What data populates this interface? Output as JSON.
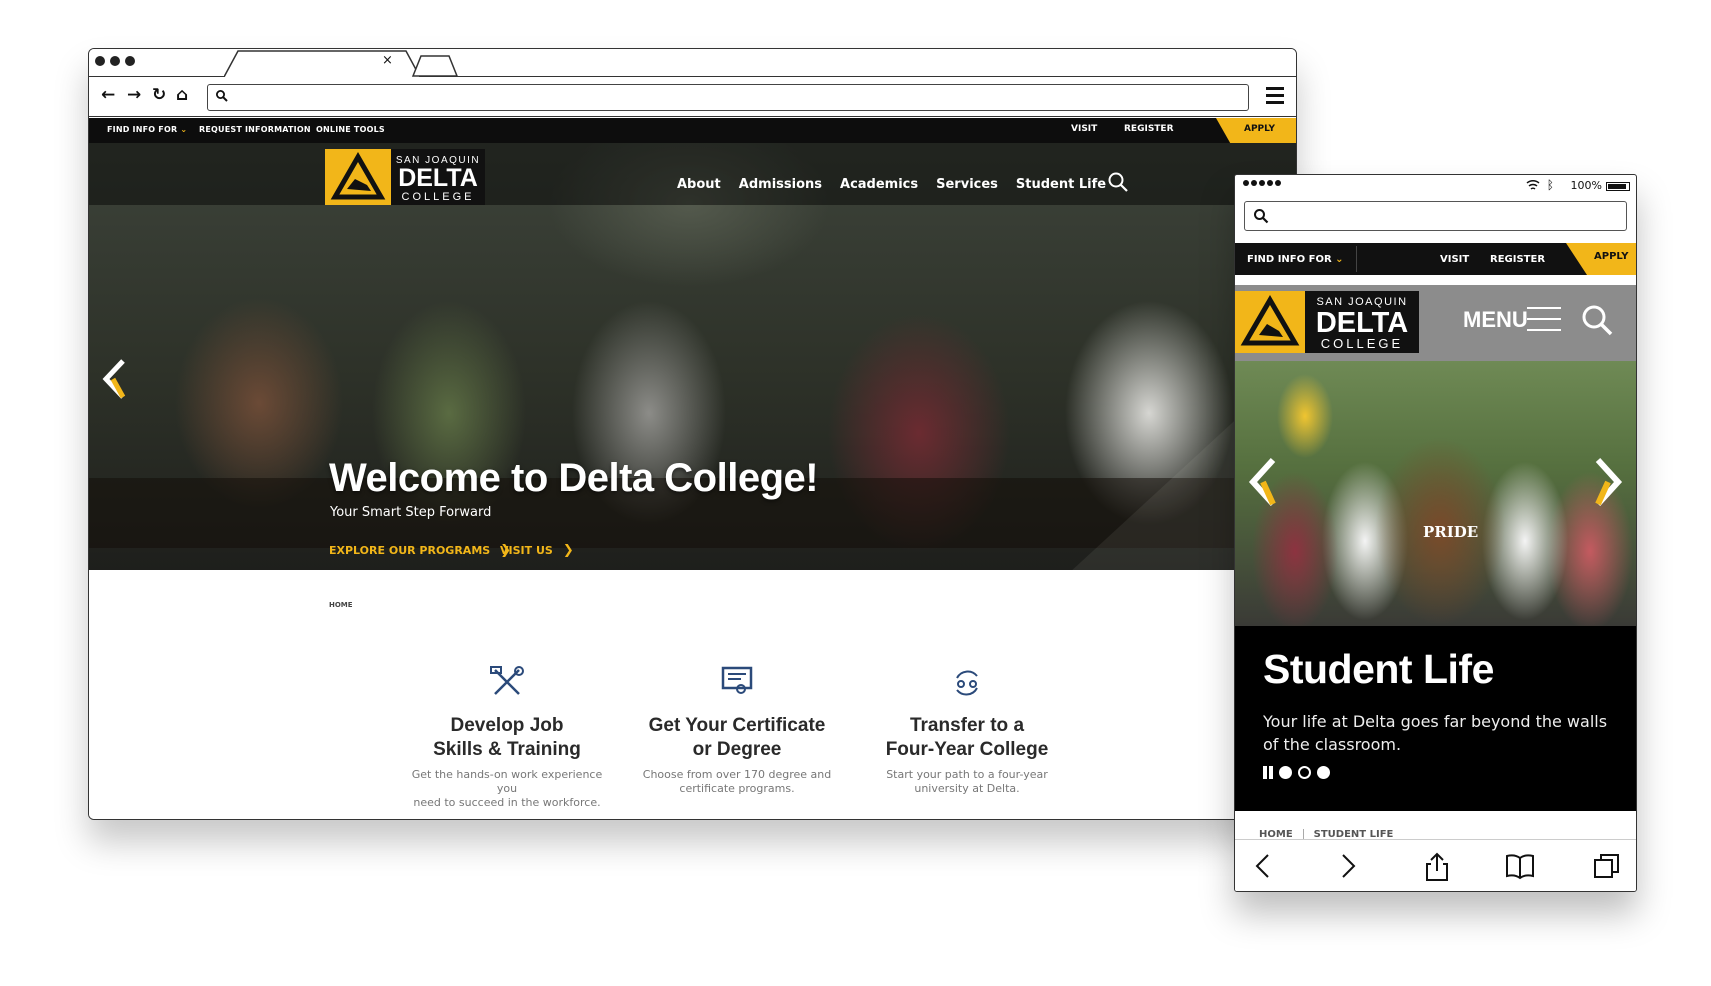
{
  "desktop": {
    "browser": {
      "tab_close": "×",
      "nav_back": "←",
      "nav_forward": "→",
      "nav_reload": "↻",
      "nav_home": "⌂",
      "address_value": ""
    },
    "utility": {
      "find_info": "FIND INFO FOR",
      "request_info": "REQUEST INFORMATION",
      "online_tools": "ONLINE TOOLS",
      "visit": "VISIT",
      "register": "REGISTER",
      "apply": "APPLY"
    },
    "logo": {
      "top": "SAN JOAQUIN",
      "main": "DELTA",
      "bottom": "COLLEGE"
    },
    "nav": [
      "About",
      "Admissions",
      "Academics",
      "Services",
      "Student Life"
    ],
    "hero": {
      "title": "Welcome to Delta College!",
      "tagline": "Your Smart Step Forward",
      "cta_programs": "EXPLORE OUR PROGRAMS",
      "cta_visit": "VISIT US"
    },
    "breadcrumb": "HOME",
    "features": [
      {
        "icon": "tools-icon",
        "title_1": "Develop Job",
        "title_2": "Skills & Training",
        "desc_1": "Get the hands-on work experience you",
        "desc_2": "need to succeed in the workforce."
      },
      {
        "icon": "certificate-icon",
        "title_1": "Get Your Certificate",
        "title_2": "or Degree",
        "desc_1": "Choose from over 170 degree and",
        "desc_2": "certificate programs."
      },
      {
        "icon": "transfer-icon",
        "title_1": "Transfer to a",
        "title_2": "Four-Year College",
        "desc_1": "Start your path to a four-year",
        "desc_2": "university at Delta."
      }
    ]
  },
  "mobile": {
    "status": {
      "battery": "100%"
    },
    "search_value": "",
    "utility": {
      "find_info": "FIND INFO FOR",
      "visit": "VISIT",
      "register": "REGISTER",
      "apply": "APPLY"
    },
    "logo": {
      "top": "SAN JOAQUIN",
      "main": "DELTA",
      "bottom": "COLLEGE"
    },
    "menu_label": "MENU",
    "photo_shirt": "PRIDE",
    "slide": {
      "title": "Student Life",
      "subtitle": "Your life at Delta goes far beyond the walls of the classroom."
    },
    "breadcrumb": [
      "HOME",
      "STUDENT LIFE"
    ]
  },
  "colors": {
    "accent": "#f2b619",
    "dark": "#0d0d0d",
    "header_gray": "#8c8c8c"
  }
}
